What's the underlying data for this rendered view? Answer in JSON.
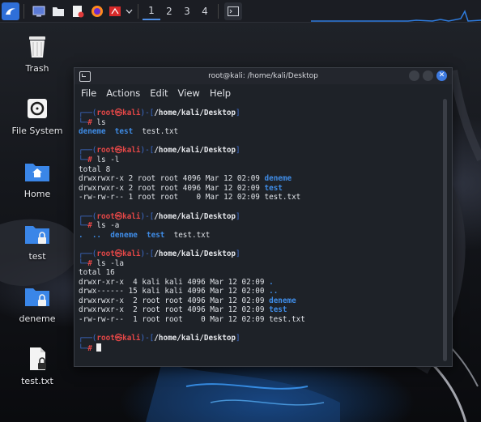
{
  "taskbar": {
    "workspaces": [
      "1",
      "2",
      "3",
      "4"
    ],
    "active_workspace": "1",
    "accent_color": "#4f8fe6"
  },
  "desktop": {
    "icons": [
      {
        "label": "Trash",
        "icon": "trash-icon"
      },
      {
        "label": "File System",
        "icon": "drive-icon"
      },
      {
        "label": "Home",
        "icon": "home-folder-icon"
      },
      {
        "label": "test",
        "icon": "locked-folder-icon"
      },
      {
        "label": "deneme",
        "icon": "locked-folder-icon"
      },
      {
        "label": "test.txt",
        "icon": "locked-file-icon"
      }
    ]
  },
  "window": {
    "title": "root@kali: /home/kali/Desktop",
    "menu": [
      "File",
      "Actions",
      "Edit",
      "View",
      "Help"
    ]
  },
  "terminal": {
    "prompt": {
      "user": "root",
      "at": "㉿",
      "host": "kali",
      "path": "/home/kali/Desktop",
      "symbol": "#"
    },
    "blocks": [
      {
        "command": "ls",
        "output": [
          [
            {
              "t": "deneme",
              "c": "dir"
            },
            {
              "t": "  "
            },
            {
              "t": "test",
              "c": "dir"
            },
            {
              "t": "  test.txt"
            }
          ]
        ]
      },
      {
        "command": "ls -l",
        "output": [
          [
            {
              "t": "total 8"
            }
          ],
          [
            {
              "t": "drwxrwxr-x 2 root root 4096 Mar 12 02:09 "
            },
            {
              "t": "deneme",
              "c": "dir"
            }
          ],
          [
            {
              "t": "drwxrwxr-x 2 root root 4096 Mar 12 02:09 "
            },
            {
              "t": "test",
              "c": "dir"
            }
          ],
          [
            {
              "t": "-rw-rw-r-- 1 root root    0 Mar 12 02:09 test.txt"
            }
          ]
        ]
      },
      {
        "command": "ls -a",
        "output": [
          [
            {
              "t": ".",
              "c": "dir"
            },
            {
              "t": "  "
            },
            {
              "t": "..",
              "c": "dir"
            },
            {
              "t": "  "
            },
            {
              "t": "deneme",
              "c": "dir"
            },
            {
              "t": "  "
            },
            {
              "t": "test",
              "c": "dir"
            },
            {
              "t": "  test.txt"
            }
          ]
        ]
      },
      {
        "command": "ls -la",
        "output": [
          [
            {
              "t": "total 16"
            }
          ],
          [
            {
              "t": "drwxr-xr-x  4 kali kali 4096 Mar 12 02:09 "
            },
            {
              "t": ".",
              "c": "dir"
            }
          ],
          [
            {
              "t": "drwx------ 15 kali kali 4096 Mar 12 02:00 "
            },
            {
              "t": "..",
              "c": "dir"
            }
          ],
          [
            {
              "t": "drwxrwxr-x  2 root root 4096 Mar 12 02:09 "
            },
            {
              "t": "deneme",
              "c": "dir"
            }
          ],
          [
            {
              "t": "drwxrwxr-x  2 root root 4096 Mar 12 02:09 "
            },
            {
              "t": "test",
              "c": "dir"
            }
          ],
          [
            {
              "t": "-rw-rw-r--  1 root root    0 Mar 12 02:09 test.txt"
            }
          ]
        ]
      },
      {
        "command": "",
        "output": []
      }
    ],
    "colors": {
      "bracket": "#3f6fd1",
      "user": "#e34747",
      "directory": "#3f8ce6"
    }
  }
}
